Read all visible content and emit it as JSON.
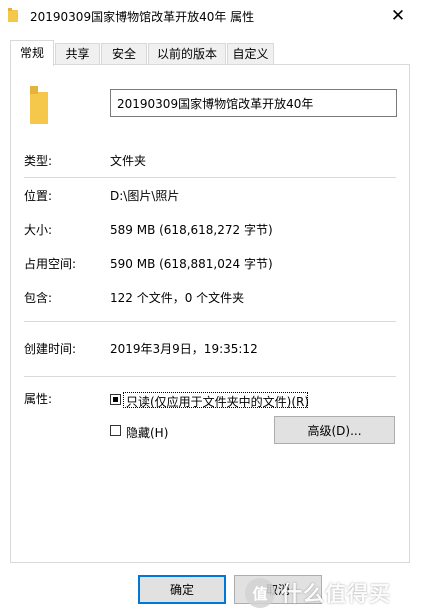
{
  "window": {
    "title": "20190309国家博物馆改革开放40年 属性",
    "close_label": "✕"
  },
  "tabs": [
    {
      "label": "常规",
      "active": true
    },
    {
      "label": "共享",
      "active": false
    },
    {
      "label": "安全",
      "active": false
    },
    {
      "label": "以前的版本",
      "active": false
    },
    {
      "label": "自定义",
      "active": false
    }
  ],
  "general": {
    "name_value": "20190309国家博物馆改革开放40年",
    "type_label": "类型:",
    "type_value": "文件夹",
    "location_label": "位置:",
    "location_value": "D:\\图片\\照片",
    "size_label": "大小:",
    "size_value": "589 MB (618,618,272 字节)",
    "disk_size_label": "占用空间:",
    "disk_size_value": "590 MB (618,881,024 字节)",
    "contains_label": "包含:",
    "contains_value": "122 个文件，0 个文件夹",
    "created_label": "创建时间:",
    "created_value": "2019年3月9日，19:35:12",
    "attributes_label": "属性:",
    "readonly_label": "只读(仅应用于文件夹中的文件)(R)",
    "readonly_checked": true,
    "hidden_label": "隐藏(H)",
    "hidden_checked": false,
    "advanced_label": "高级(D)..."
  },
  "footer": {
    "ok_label": "确定",
    "cancel_label": "取消"
  },
  "watermark": {
    "glyph": "值",
    "text": "什么值得买"
  },
  "colors": {
    "folder": "#f5c84c",
    "focus_border": "#0078d7"
  }
}
